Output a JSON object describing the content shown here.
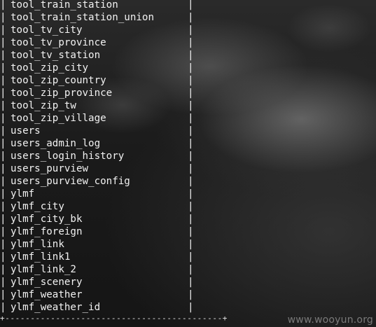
{
  "terminal": {
    "rows": [
      "tool_train_station",
      "tool_train_station_union",
      "tool_tv_city",
      "tool_tv_province",
      "tool_tv_station",
      "tool_zip_city",
      "tool_zip_country",
      "tool_zip_province",
      "tool_zip_tw",
      "tool_zip_village",
      "users",
      "users_admin_log",
      "users_login_history",
      "users_purview",
      "users_purview_config",
      "ylmf",
      "ylmf_city",
      "ylmf_city_bk",
      "ylmf_foreign",
      "ylmf_link",
      "ylmf_link1",
      "ylmf_link_2",
      "ylmf_scenery",
      "ylmf_weather",
      "ylmf_weather_id"
    ],
    "separator": "|",
    "bottom_border": "+-------------------------------------------+"
  },
  "watermark": "www.wooyun.org"
}
